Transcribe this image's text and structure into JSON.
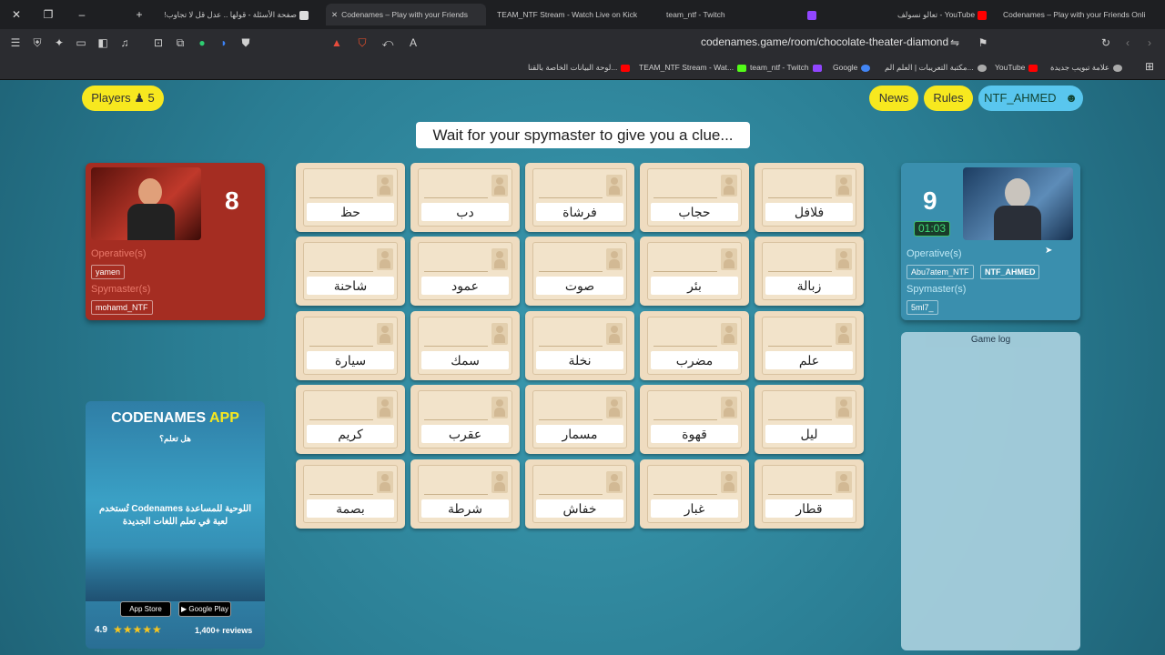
{
  "browser": {
    "tabs": [
      {
        "label": "صفحة الأسئلة - قولها .. عدل قل لا تجاوب!",
        "active": false
      },
      {
        "label": "Codenames – Play with your Friends",
        "active": true
      },
      {
        "label": "TEAM_NTF Stream - Watch Live on Kick",
        "active": false
      },
      {
        "label": "team_ntf - Twitch",
        "active": false
      },
      {
        "label": "تعالو نسولف - YouTube",
        "active": false
      },
      {
        "label": "Codenames – Play with your Friends Onli",
        "active": false
      }
    ],
    "url": "codenames.game/room/chocolate-theater-diamond",
    "bookmarks": [
      "لوحة البيانات الخاصة بالقنا...",
      "TEAM_NTF Stream - Wat...",
      "team_ntf - Twitch",
      "Google",
      "مكتبة التعريبات | العلم الم...",
      "YouTube",
      "علامة تبويب جديدة"
    ]
  },
  "game": {
    "players_label": "Players",
    "players_count": "5",
    "news": "News",
    "rules": "Rules",
    "user": "NTF_AHMED",
    "clue": "Wait for your spymaster to give you a clue...",
    "red": {
      "score": "8",
      "operatives_label": "Operative(s)",
      "operatives": [
        "yamen"
      ],
      "spymaster_label": "Spymaster(s)",
      "spymasters": [
        "mohamd_NTF"
      ]
    },
    "blue": {
      "score": "9",
      "timer": "01:03",
      "operatives_label": "Operative(s)",
      "operatives": [
        "Abu7atem_NTF",
        "NTF_AHMED"
      ],
      "spymaster_label": "Spymaster(s)",
      "spymasters": [
        "5ml7_"
      ]
    },
    "gamelog_label": "Game log",
    "cards": [
      [
        "حظ",
        "دب",
        "فرشاة",
        "حجاب",
        "فلافل"
      ],
      [
        "شاحنة",
        "عمود",
        "صوت",
        "بئر",
        "زبالة"
      ],
      [
        "سيارة",
        "سمك",
        "نخلة",
        "مضرب",
        "علم"
      ],
      [
        "كريم",
        "عقرب",
        "مسمار",
        "قهوة",
        "ليل"
      ],
      [
        "بصمة",
        "شرطة",
        "خفاش",
        "غبار",
        "قطار"
      ]
    ],
    "ad": {
      "title1": "CODENAMES",
      "title2": "APP",
      "question": "هل تعلم؟",
      "body": "اللوحية للمساعدة Codenames تُستخدم لعبة في تعلم اللغات الجديدة",
      "appstore": "App Store",
      "googleplay": "Google Play",
      "rating": "4.9",
      "reviews": "1,400+ reviews"
    }
  }
}
